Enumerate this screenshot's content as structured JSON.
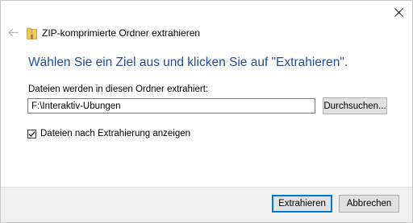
{
  "window": {
    "title": "ZIP-komprimierte Ordner extrahieren",
    "back_icon": "back-arrow-icon",
    "close_icon": "close-icon",
    "zip_icon": "zip-folder-icon"
  },
  "main": {
    "heading": "Wählen Sie ein Ziel aus und klicken Sie auf \"Extrahieren\".",
    "folder_label": "Dateien werden in diesen Ordner extrahiert:",
    "path_value": "F:\\Interaktiv-Übungen",
    "browse_label": "Durchsuchen...",
    "show_files_label": "Dateien nach Extrahierung anzeigen",
    "show_files_checked": true
  },
  "footer": {
    "extract_label": "Extrahieren",
    "cancel_label": "Abbrechen"
  },
  "colors": {
    "heading": "#1e4e9c",
    "accent": "#0078d7",
    "footer_bg": "#f0f0f0"
  }
}
